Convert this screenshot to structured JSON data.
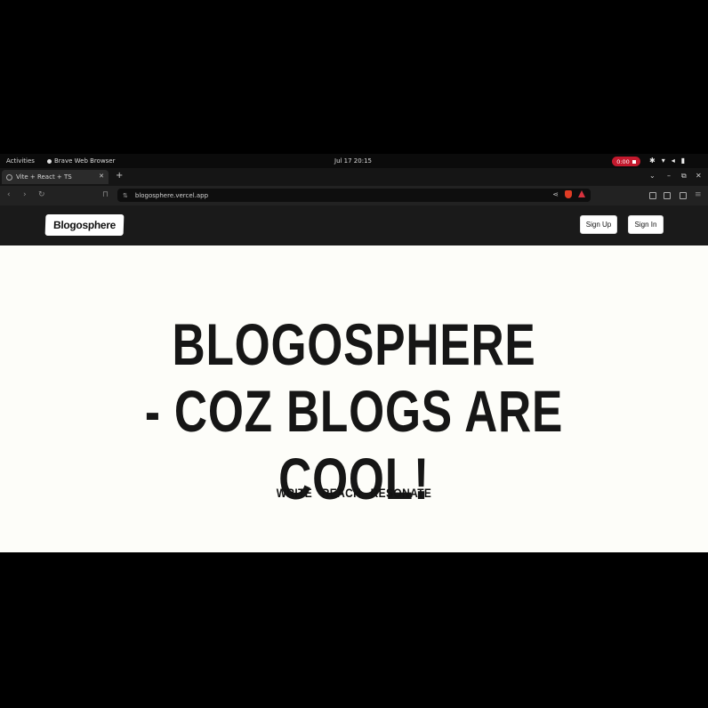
{
  "system_bar": {
    "activities": "Activities",
    "app_name": "Brave Web Browser",
    "clock": "Jul 17  20:15",
    "recording": "0:00"
  },
  "browser": {
    "tab_title": "Vite + React + TS",
    "url": "blogosphere.vercel.app"
  },
  "header": {
    "logo": "Blogosphere",
    "signup_label": "Sign Up",
    "signin_label": "Sign In"
  },
  "hero": {
    "line1": "BLOGOSPHERE",
    "line2": "- COZ BLOGS ARE COOL!",
    "tagline": [
      "WRITE",
      "REACH",
      "RESONATE"
    ]
  },
  "colors": {
    "header_bg": "#1a1a1a",
    "page_bg": "#fdfdf9",
    "record_red": "#c3192d",
    "brave_orange": "#e03c24"
  }
}
